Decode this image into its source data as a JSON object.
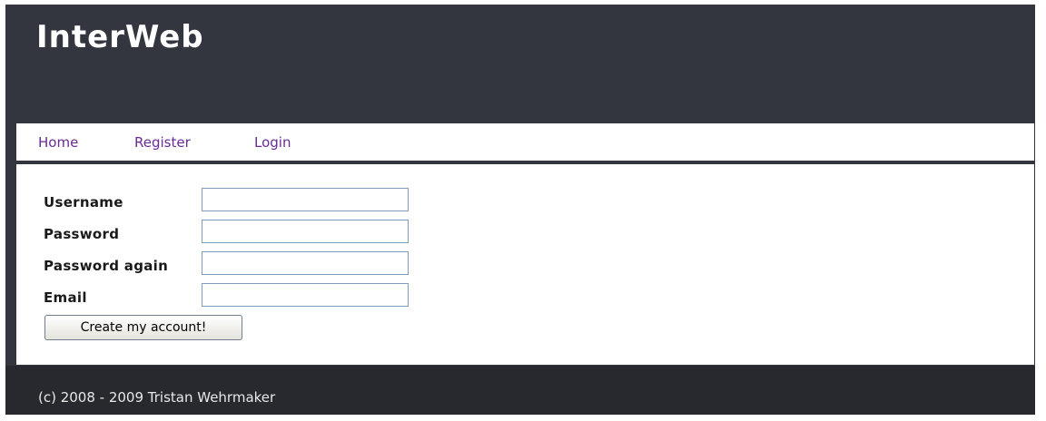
{
  "header": {
    "title": "InterWeb"
  },
  "nav": {
    "items": [
      "Home",
      "Register",
      "Login"
    ]
  },
  "form": {
    "fields": [
      {
        "label": "Username",
        "value": ""
      },
      {
        "label": "Password",
        "value": ""
      },
      {
        "label": "Password again",
        "value": ""
      },
      {
        "label": "Email",
        "value": ""
      }
    ],
    "submit_label": "Create my account!"
  },
  "footer": {
    "text": "(c) 2008 - 2009 Tristan Wehrmaker"
  },
  "colors": {
    "header_bg": "#33363f",
    "footer_bg": "#27292f",
    "link": "#6a2a96",
    "content_bg": "#ffffff"
  }
}
